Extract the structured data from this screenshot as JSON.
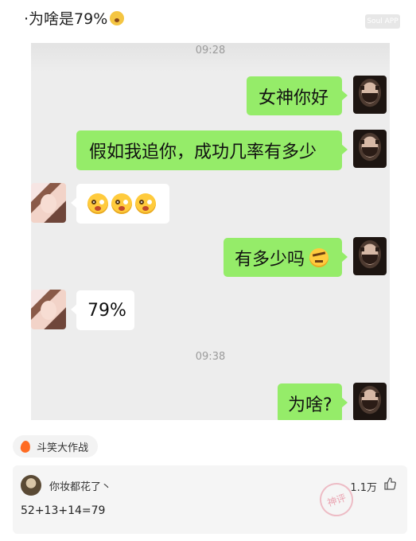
{
  "post": {
    "title": "·为啥是79%",
    "watermark": "Soul APP"
  },
  "chat": {
    "timestamps": [
      "09:28",
      "09:38"
    ],
    "messages": [
      {
        "side": "right",
        "text": "女神你好"
      },
      {
        "side": "right",
        "text": "假如我追你，成功几率有多少"
      },
      {
        "side": "left",
        "text": ""
      },
      {
        "side": "right",
        "text": "有多少吗"
      },
      {
        "side": "left",
        "text": "79%"
      },
      {
        "side": "right",
        "text": "为啥?"
      }
    ],
    "colors": {
      "background": "#ededed",
      "sent_bubble": "#95ec69",
      "received_bubble": "#ffffff"
    }
  },
  "tag": {
    "label": "斗笑大作战",
    "icon": "flame-icon"
  },
  "comment": {
    "username": "你妆都花了丶",
    "likes": "1.1万",
    "text": "52+13+14=79",
    "stamp_text": "神评"
  }
}
